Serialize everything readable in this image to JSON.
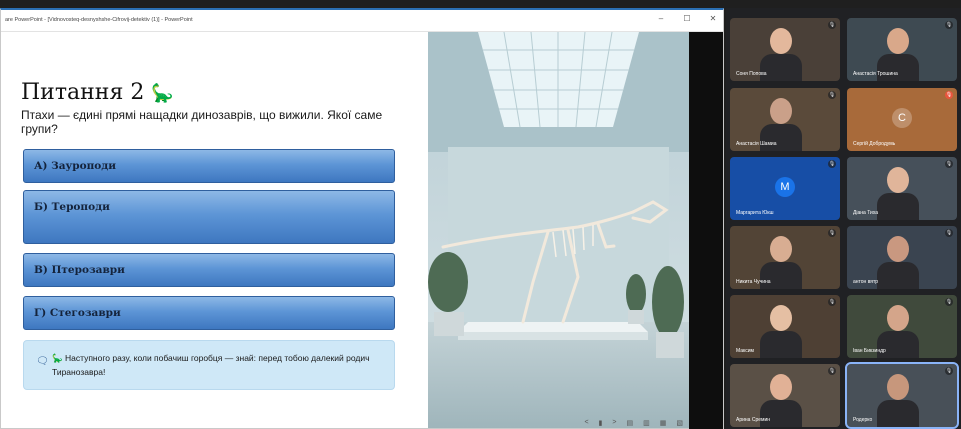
{
  "window": {
    "title": "are PowerPoint - [Vidnovosteq-desnyshshe-Cifrovij-detektiv (1)] - PowerPoint",
    "controls": [
      "–",
      "☐",
      "✕"
    ]
  },
  "slide": {
    "title": "Питання 2",
    "title_emoji": "🦕",
    "question": "Птахи — єдині прямі нащадки динозаврів, що вижили. Якої саме групи?",
    "answers": [
      {
        "label": "А) Зауроподи"
      },
      {
        "label": "Б) Тероподи"
      },
      {
        "label": "В) Птерозаври"
      },
      {
        "label": "Г) Стегозаври"
      }
    ],
    "callout": {
      "icon": "🗨",
      "emoji": "🦕",
      "text": "Наступного разу, коли побачиш горобця — знай: перед тобою далекий родич Тиранозавра!"
    },
    "controls": [
      "<",
      "▮",
      ">",
      "▤",
      "▥",
      "▦",
      "▧"
    ]
  },
  "meet": {
    "participants": [
      {
        "name": "Соня Попова",
        "type": "video",
        "mic": "muted"
      },
      {
        "name": "Анастасія Трошина",
        "type": "video",
        "mic": "muted"
      },
      {
        "name": "Анастасія Шамиа",
        "type": "video",
        "mic": "muted"
      },
      {
        "name": "Сергій Добродумь",
        "type": "avatar",
        "initial": "C",
        "color": "#a86a3a",
        "mic": "on"
      },
      {
        "name": "Маргарита Юкш",
        "type": "avatar",
        "initial": "M",
        "color": "#1a73e8",
        "mic": "muted"
      },
      {
        "name": "Діана Тиха",
        "type": "video",
        "mic": "muted"
      },
      {
        "name": "Никита Чучина",
        "type": "video",
        "mic": "muted"
      },
      {
        "name": "антон вятр",
        "type": "video",
        "mic": "muted"
      },
      {
        "name": "Максим",
        "type": "video",
        "mic": "muted"
      },
      {
        "name": "Іван Бикзиндр",
        "type": "video",
        "mic": "muted"
      },
      {
        "name": "Арина Сремин",
        "type": "video",
        "mic": "muted"
      },
      {
        "name": "Родерко",
        "type": "video",
        "mic": "muted"
      }
    ]
  }
}
